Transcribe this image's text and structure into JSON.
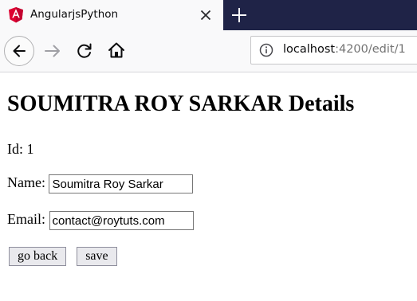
{
  "browser": {
    "tab_title": "AngularjsPython",
    "url_host": "localhost",
    "url_path": ":4200/edit/1"
  },
  "page": {
    "heading": "SOUMITRA ROY SARKAR Details",
    "id_label": "Id:",
    "id_value": "1",
    "name_label": "Name:",
    "name_value": "Soumitra Roy Sarkar",
    "email_label": "Email:",
    "email_value": "contact@roytuts.com",
    "go_back_label": "go back",
    "save_label": "save"
  },
  "icons": {
    "favicon": "angular-logo-icon",
    "tab_close": "close-icon",
    "new_tab": "plus-icon",
    "back": "arrow-left-icon",
    "forward": "arrow-right-icon",
    "reload": "reload-icon",
    "home": "home-icon",
    "site_info": "info-icon"
  },
  "colors": {
    "tabstrip_bg": "#1f2347",
    "angular_red": "#dd0031",
    "toolbar_bg": "#f9f9fa"
  }
}
